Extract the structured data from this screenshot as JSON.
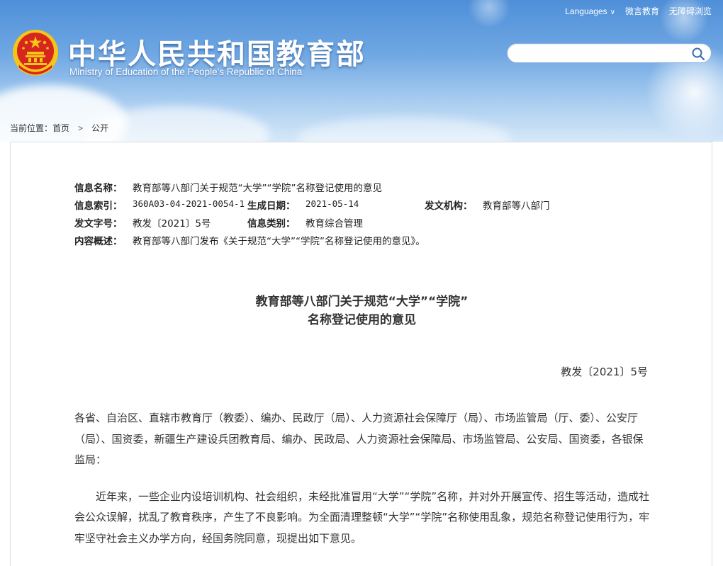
{
  "header": {
    "title": "中华人民共和国教育部",
    "subtitle": "Ministry of Education of the People's Republic of China",
    "top_links": {
      "languages": "Languages",
      "weibo": "微言教育",
      "accessibility": "无障碍浏览"
    },
    "search": {
      "value": "",
      "placeholder": ""
    },
    "colors": {
      "banner_top": "#4f8fd8",
      "banner_bottom": "#d6e8f8",
      "emblem_red": "#d7261e",
      "emblem_gold": "#f5c518"
    }
  },
  "breadcrumb": {
    "prefix": "当前位置：",
    "home": "首页",
    "separator": ">",
    "current": "公开"
  },
  "meta": {
    "name_label": "信息名称：",
    "name_value": "教育部等八部门关于规范“大学”“学院”名称登记使用的意见",
    "index_label": "信息索引：",
    "index_value": "360A03-04-2021-0054-1",
    "date_label": "生成日期：",
    "date_value": "2021-05-14",
    "issuer_label": "发文机构：",
    "issuer_value": "教育部等八部门",
    "docno_label": "发文字号：",
    "docno_value": "教发〔2021〕5号",
    "category_label": "信息类别：",
    "category_value": "教育综合管理",
    "summary_label": "内容概述：",
    "summary_value": "教育部等八部门发布《关于规范“大学”“学院”名称登记使用的意见》。"
  },
  "document": {
    "title_line1": "教育部等八部门关于规范“大学”“学院”",
    "title_line2": "名称登记使用的意见",
    "number": "教发〔2021〕5号",
    "paragraph1": "各省、自治区、直辖市教育厅（教委）、编办、民政厅（局）、人力资源社会保障厅（局）、市场监管局（厅、委）、公安厅（局）、国资委，新疆生产建设兵团教育局、编办、民政局、人力资源社会保障局、市场监管局、公安局、国资委，各银保监局：",
    "paragraph2": "近年来，一些企业内设培训机构、社会组织，未经批准冒用“大学”“学院”名称，并对外开展宣传、招生等活动，造成社会公众误解，扰乱了教育秩序，产生了不良影响。为全面清理整顿“大学”“学院”名称使用乱象，规范名称登记使用行为，牢牢坚守社会主义办学方向，经国务院同意，现提出如下意见。"
  }
}
